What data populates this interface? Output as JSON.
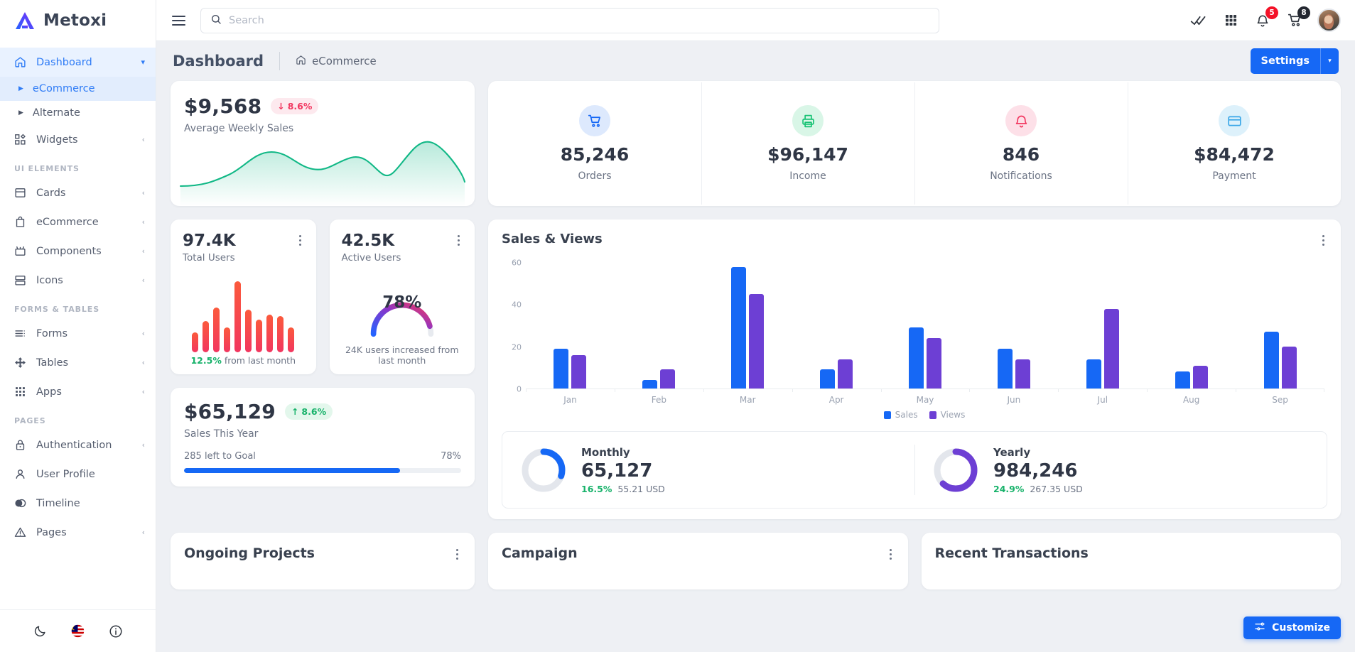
{
  "brand": {
    "name": "Metoxi",
    "logo_icon": "triangle-logo-icon"
  },
  "sidebar": {
    "items": [
      {
        "label": "Dashboard",
        "icon": "home-icon",
        "active": true,
        "chevron": "⌄"
      },
      {
        "label": "eCommerce",
        "icon": "caret-right-icon",
        "sub": true,
        "active": true
      },
      {
        "label": "Alternate",
        "icon": "caret-right-icon",
        "sub": true,
        "active": false
      },
      {
        "label": "Widgets",
        "icon": "widgets-icon",
        "chevron": "‹"
      }
    ],
    "section_ui": "UI ELEMENTS",
    "ui_items": [
      {
        "label": "Cards",
        "icon": "card-icon",
        "chevron": "‹"
      },
      {
        "label": "eCommerce",
        "icon": "bag-icon",
        "chevron": "‹"
      },
      {
        "label": "Components",
        "icon": "components-icon",
        "chevron": "‹"
      },
      {
        "label": "Icons",
        "icon": "icons-icon",
        "chevron": "‹"
      }
    ],
    "section_forms": "FORMS & TABLES",
    "form_items": [
      {
        "label": "Forms",
        "icon": "forms-icon",
        "chevron": "‹"
      },
      {
        "label": "Tables",
        "icon": "tables-icon",
        "chevron": "‹"
      },
      {
        "label": "Apps",
        "icon": "apps-grid-icon",
        "chevron": "‹"
      }
    ],
    "section_pages": "PAGES",
    "page_items": [
      {
        "label": "Authentication",
        "icon": "lock-icon",
        "chevron": "‹"
      },
      {
        "label": "User Profile",
        "icon": "user-icon"
      },
      {
        "label": "Timeline",
        "icon": "timeline-icon"
      },
      {
        "label": "Pages",
        "icon": "warning-triangle-icon",
        "chevron": "‹"
      }
    ],
    "footer": [
      {
        "name": "dark-mode-icon"
      },
      {
        "name": "language-flag-icon"
      },
      {
        "name": "info-icon"
      }
    ]
  },
  "topbar": {
    "menu_icon": "hamburger-menu-icon",
    "search": {
      "placeholder": "Search",
      "value": "",
      "icon": "search-icon"
    },
    "check_icon": "double-check-icon",
    "apps_icon": "apps-grid-icon",
    "bell_icon": "bell-icon",
    "bell_badge": "5",
    "cart_icon": "cart-icon",
    "cart_badge": "8",
    "avatar": "user-avatar"
  },
  "page": {
    "title": "Dashboard",
    "breadcrumb": {
      "icon": "home-icon",
      "label": "eCommerce"
    },
    "settings_button": {
      "label": "Settings",
      "caret": "▾"
    }
  },
  "weekly_sales": {
    "value": "$9,568",
    "delta": "8.6%",
    "delta_dir": "down",
    "delta_arrow": "↓",
    "label": "Average Weekly Sales",
    "line_color": "#11b886"
  },
  "stats": [
    {
      "value": "85,246",
      "label": "Orders",
      "icon": "cart-icon",
      "color": "#1668f5",
      "bg": "#dde9fd"
    },
    {
      "value": "$96,147",
      "label": "Income",
      "icon": "printer-icon",
      "color": "#16c273",
      "bg": "#d9f6e7"
    },
    {
      "value": "846",
      "label": "Notifications",
      "icon": "bell-icon",
      "color": "#f2365f",
      "bg": "#fde0e8"
    },
    {
      "value": "$84,472",
      "label": "Payment",
      "icon": "credit-card-icon",
      "color": "#3aa7e8",
      "bg": "#ddf1fb"
    }
  ],
  "total_users": {
    "value": "97.4K",
    "label": "Total Users",
    "foot_pct": "12.5%",
    "foot_text": "from last month",
    "bars": [
      24,
      38,
      54,
      30,
      86,
      52,
      40,
      46,
      44,
      30
    ]
  },
  "active_users": {
    "value": "42.5K",
    "label": "Active Users",
    "gauge_pct": "78%",
    "gauge_value": 78,
    "foot_text": "24K users increased from last month"
  },
  "sales_year": {
    "value": "$65,129",
    "delta": "8.6%",
    "delta_arrow": "↑",
    "label": "Sales This Year",
    "goal_text": "285 left to Goal",
    "progress_label": "78%",
    "progress": 78
  },
  "sales_views": {
    "title": "Sales & Views",
    "menu_icon": "kebab-menu-icon"
  },
  "chart_data": {
    "type": "bar",
    "title": "Sales & Views",
    "categories": [
      "Jan",
      "Feb",
      "Mar",
      "Apr",
      "May",
      "Jun",
      "Jul",
      "Aug",
      "Sep"
    ],
    "series": [
      {
        "name": "Sales",
        "color": "#1668f5",
        "values": [
          19,
          4,
          58,
          9,
          29,
          19,
          14,
          8,
          27
        ]
      },
      {
        "name": "Views",
        "color": "#6d3fd4",
        "values": [
          16,
          9,
          45,
          14,
          24,
          14,
          38,
          11,
          20
        ]
      }
    ],
    "ylabel": "",
    "xlabel": "",
    "ylim": [
      0,
      60
    ],
    "yticks": [
      60,
      40,
      20,
      0
    ],
    "grid": false,
    "legend_position": "bottom"
  },
  "donuts": [
    {
      "title": "Monthly",
      "value": "65,127",
      "pct": "16.5%",
      "amount": "55.21 USD",
      "ring_value": 30,
      "color": "#1668f5"
    },
    {
      "title": "Yearly",
      "value": "984,246",
      "pct": "24.9%",
      "amount": "267.35 USD",
      "ring_value": 62,
      "color": "#6d3fd4"
    }
  ],
  "bottom_cards": [
    {
      "title": "Ongoing Projects",
      "menu_icon": "kebab-menu-icon"
    },
    {
      "title": "Campaign",
      "menu_icon": "kebab-menu-icon"
    },
    {
      "title": "Recent Transactions",
      "menu_icon": "kebab-menu-icon"
    }
  ],
  "customize_button": {
    "label": "Customize",
    "icon": "sliders-icon"
  }
}
